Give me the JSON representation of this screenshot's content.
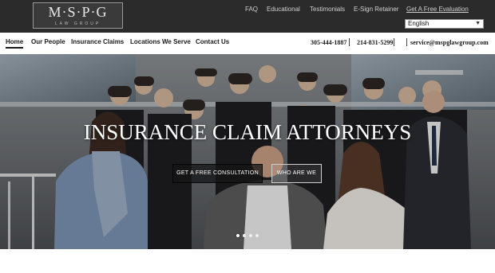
{
  "header": {
    "logo_text": "M·S·P·G",
    "logo_subtext": "LAW GROUP",
    "top_links": [
      "FAQ",
      "Educational",
      "Testimonials",
      "E-Sign Retainer",
      "Get A Free Evaluation"
    ],
    "language": "English"
  },
  "nav": {
    "items": [
      "Home",
      "Our People",
      "Insurance Claims",
      "Locations We Serve",
      "Contact Us"
    ],
    "active": "Home",
    "phone_1": "305-444-1887",
    "phone_2": "214-831-5299",
    "email": "service@mspglawgroup.com"
  },
  "hero": {
    "title": "INSURANCE CLAIM ATTORNEYS",
    "primary_cta": "GET A FREE CONSULTATION",
    "secondary_cta": "WHO ARE WE",
    "slides_total": 4,
    "active_slide": 1
  },
  "colors": {
    "topbar": "#2b2b2b",
    "nav_text": "#1a1a1a",
    "hero_overlay": "#6f7276",
    "cta_primary_bg": "#141414"
  }
}
